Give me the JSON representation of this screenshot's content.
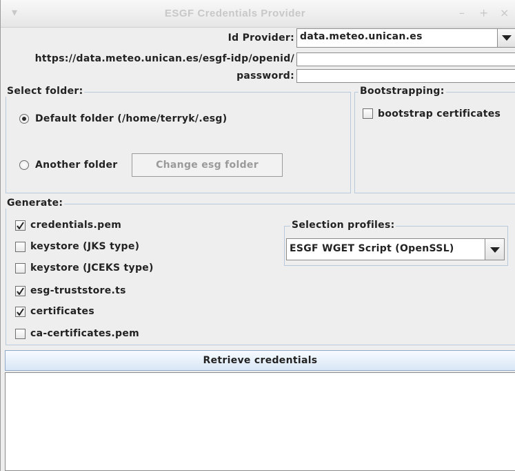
{
  "window": {
    "title": "ESGF Credentials Provider",
    "menu_glyph": "▾",
    "minimize_glyph": "–",
    "maximize_glyph": "+",
    "close_glyph": "×"
  },
  "form": {
    "id_provider_label": "Id Provider:",
    "id_provider_value": "data.meteo.unican.es",
    "openid_label": "https://data.meteo.unican.es/esgf-idp/openid/",
    "openid_value": "",
    "password_label": "password:",
    "password_value": ""
  },
  "select_folder": {
    "title": "Select folder:",
    "default_label": "Default folder (/home/terryk/.esg)",
    "default_selected": true,
    "another_label": "Another folder",
    "another_selected": false,
    "change_button": "Change esg folder"
  },
  "bootstrapping": {
    "title": "Bootstrapping:",
    "bootstrap_label": "bootstrap certificates",
    "bootstrap_checked": false
  },
  "generate": {
    "title": "Generate:",
    "options": [
      {
        "label": "credentials.pem",
        "checked": true
      },
      {
        "label": "keystore (JKS type)",
        "checked": false
      },
      {
        "label": "keystore (JCEKS type)",
        "checked": false
      },
      {
        "label": "esg-truststore.ts",
        "checked": true
      },
      {
        "label": "certificates",
        "checked": true
      },
      {
        "label": "ca-certificates.pem",
        "checked": false
      }
    ],
    "profiles_title": "Selection profiles:",
    "profile_value": "ESGF WGET Script (OpenSSL)"
  },
  "actions": {
    "retrieve_label": "Retrieve credentials"
  },
  "output": {
    "text": ""
  }
}
